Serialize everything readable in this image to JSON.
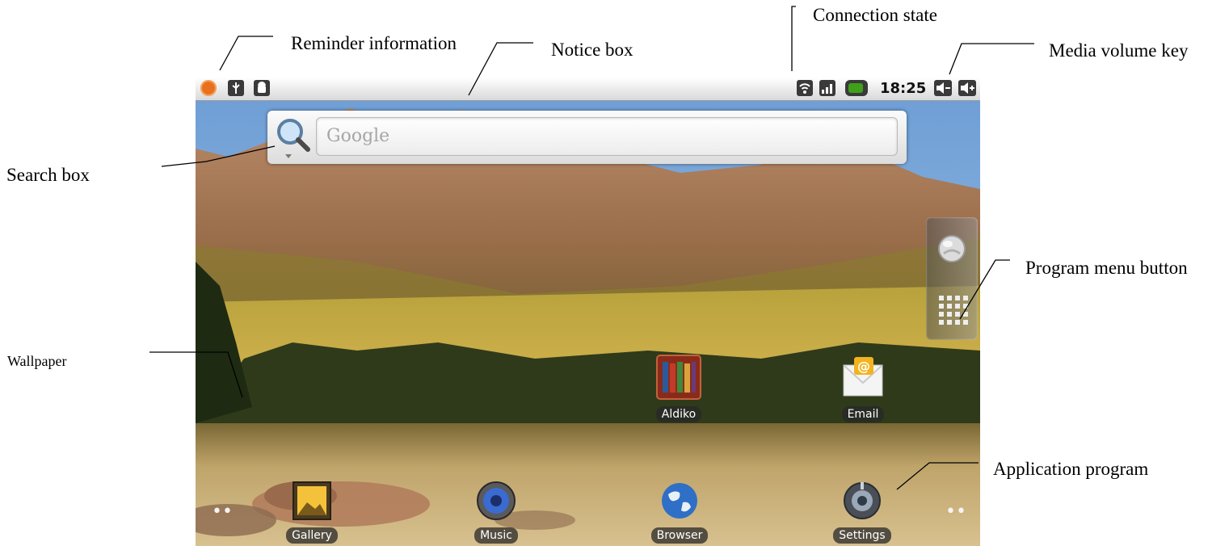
{
  "callouts": {
    "reminder": "Reminder information",
    "notice": "Notice box",
    "connection": "Connection state",
    "media_volume": "Media volume key",
    "search": "Search box",
    "program_menu": "Program menu button",
    "wallpaper": "Wallpaper",
    "application": "Application program"
  },
  "status_bar": {
    "notification_icons": [
      "alert-icon",
      "usb-icon",
      "android-debug-icon"
    ],
    "connection_icons": [
      "wifi-icon",
      "signal-icon",
      "battery-icon"
    ],
    "time": "18:25",
    "volume_icons": [
      "volume-down-icon",
      "volume-up-icon"
    ]
  },
  "search": {
    "placeholder": "Google",
    "icon": "magnifier-icon"
  },
  "desktop_apps": [
    {
      "label": "Aldiko",
      "icon": "books-icon"
    },
    {
      "label": "Email",
      "icon": "email-icon"
    }
  ],
  "dock_apps": [
    {
      "label": "Gallery",
      "icon": "gallery-icon"
    },
    {
      "label": "Music",
      "icon": "speaker-icon"
    },
    {
      "label": "Browser",
      "icon": "globe-icon"
    },
    {
      "label": "Settings",
      "icon": "settings-icon"
    }
  ],
  "side_panel": {
    "buttons": [
      "globe-button-icon",
      "app-grid-icon"
    ]
  },
  "page_dots": [
    "••",
    "••"
  ],
  "colors": {
    "statusbar_bg": "#e9e9e9",
    "label_bg": "#333333",
    "alert_orange": "#e8701f",
    "battery_green": "#3fa01a"
  }
}
